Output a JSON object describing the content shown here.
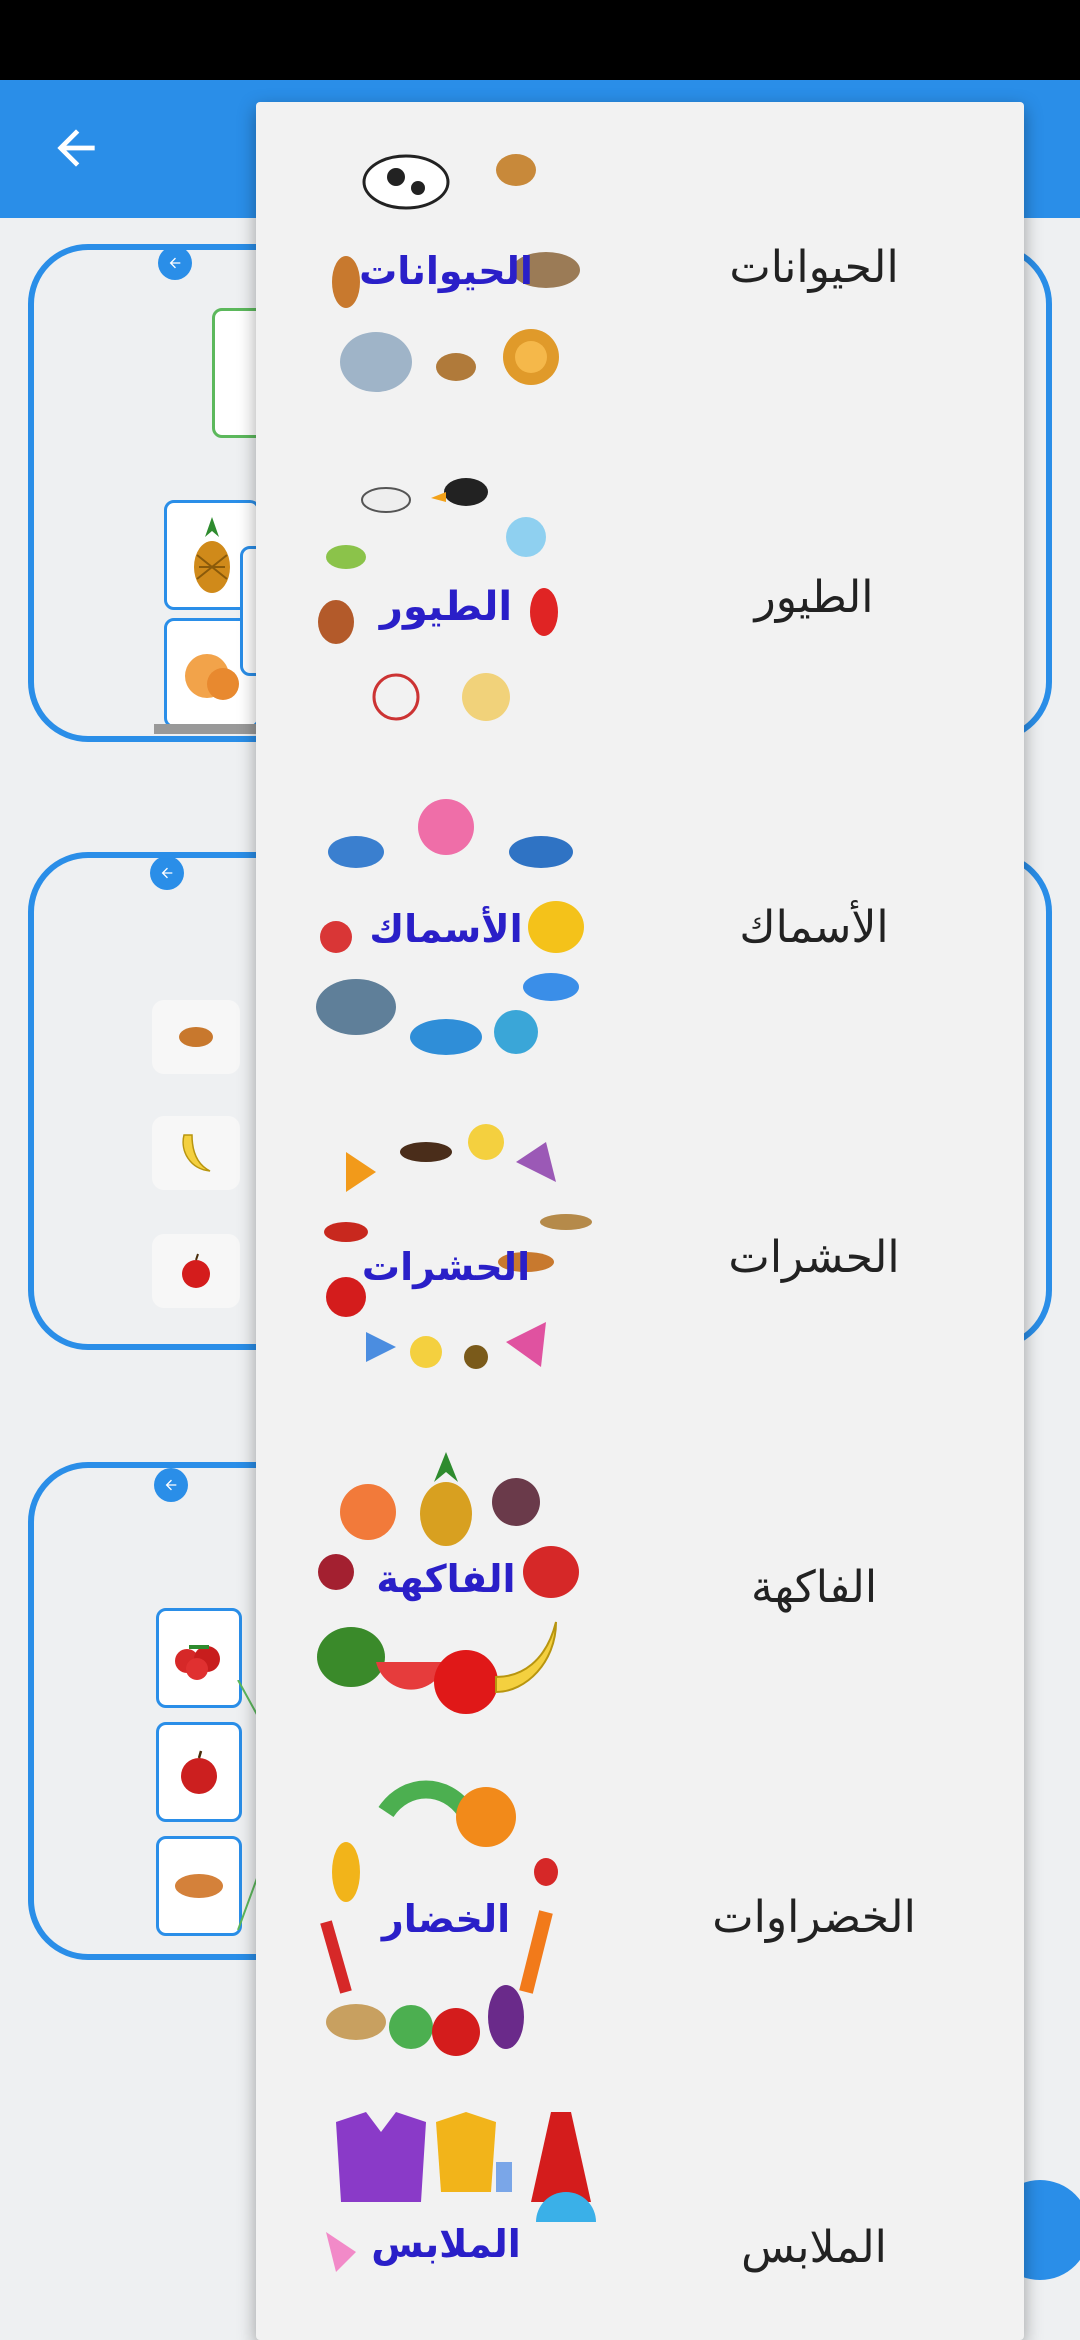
{
  "app_bar": {
    "back_icon": "arrow-left-icon"
  },
  "colors": {
    "accent": "#2a8ee8",
    "menu_bg": "#f2f2f2",
    "title_blue": "#2a1fc8"
  },
  "menu": {
    "items": [
      {
        "label": "الحيوانات",
        "image_title": "الحيوانات",
        "icon": "animals-category-image"
      },
      {
        "label": "الطيور",
        "image_title": "الطيور",
        "icon": "birds-category-image"
      },
      {
        "label": "الأسماك",
        "image_title": "الأسماك",
        "icon": "fish-category-image"
      },
      {
        "label": "الحشرات",
        "image_title": "الحشرات",
        "icon": "insects-category-image"
      },
      {
        "label": "الفاكهة",
        "image_title": "الفاكهة",
        "icon": "fruits-category-image"
      },
      {
        "label": "الخضراوات",
        "image_title": "الخضار",
        "icon": "vegetables-category-image"
      },
      {
        "label": "الملابس",
        "image_title": "الملابس",
        "icon": "clothes-category-image"
      }
    ]
  }
}
